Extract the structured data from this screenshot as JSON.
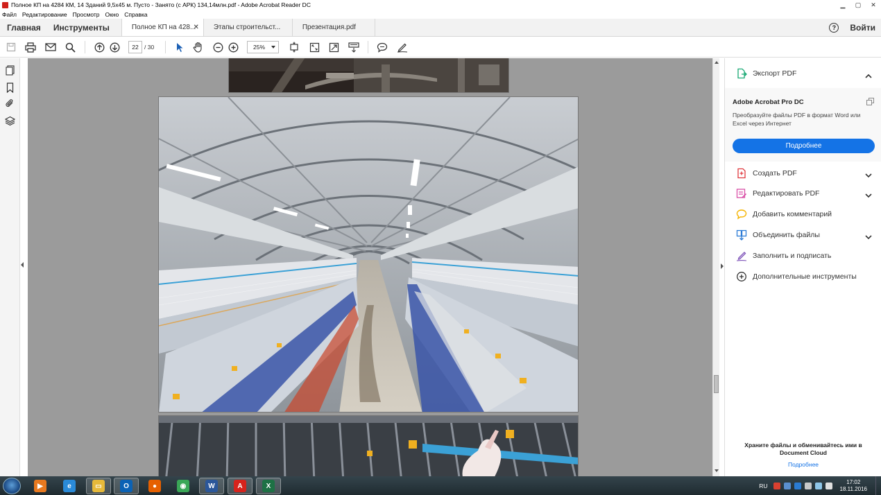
{
  "window": {
    "title": "Полное КП на 4284 КМ, 14 Зданий 9,5х45 м. Пусто - Занято (с АРК) 134,14млн.pdf - Adobe Acrobat Reader DC"
  },
  "menu": [
    "Файл",
    "Редактирование",
    "Просмотр",
    "Окно",
    "Справка"
  ],
  "tabbar": {
    "home": "Главная",
    "tools": "Инструменты",
    "docs": [
      {
        "label": "Полное КП на 428...",
        "active": true
      },
      {
        "label": "Этапы строительст...",
        "active": false
      },
      {
        "label": "Презентация.pdf",
        "active": false
      }
    ],
    "help_icon": "?",
    "login": "Войти"
  },
  "toolbar": {
    "page_current": "22",
    "page_total": "/ 30",
    "zoom": "25%"
  },
  "right_panel": {
    "export_label": "Экспорт PDF",
    "promo": {
      "title": "Adobe Acrobat Pro DC",
      "description": "Преобразуйте файлы PDF в формат Word или Excel через Интернет",
      "button": "Подробнее"
    },
    "tools": [
      {
        "label": "Создать PDF",
        "icon": "create-pdf-icon",
        "color": "#e0383e",
        "expandable": true
      },
      {
        "label": "Редактировать PDF",
        "icon": "edit-pdf-icon",
        "color": "#d94fa6",
        "expandable": true
      },
      {
        "label": "Добавить комментарий",
        "icon": "comment-icon",
        "color": "#f5b400",
        "expandable": false
      },
      {
        "label": "Объединить файлы",
        "icon": "combine-files-icon",
        "color": "#2b7bd6",
        "expandable": true
      },
      {
        "label": "Заполнить и подписать",
        "icon": "fill-sign-icon",
        "color": "#7b4fb7",
        "expandable": false
      },
      {
        "label": "Дополнительные инструменты",
        "icon": "more-tools-icon",
        "color": "#333333",
        "expandable": false
      }
    ],
    "bottom_text": "Храните файлы и обменивайтесь ими в Document Cloud",
    "bottom_link": "Подробнее"
  },
  "taskbar": {
    "apps": [
      {
        "name": "media-player-icon",
        "glyph": "▶",
        "color": "#e8791f",
        "open": false
      },
      {
        "name": "internet-explorer-icon",
        "glyph": "e",
        "color": "#2a8ad8",
        "open": false
      },
      {
        "name": "file-explorer-icon",
        "glyph": "▭",
        "color": "#e6b93a",
        "open": true
      },
      {
        "name": "outlook-icon",
        "glyph": "O",
        "color": "#0b62b5",
        "open": true
      },
      {
        "name": "firefox-icon",
        "glyph": "●",
        "color": "#e66000",
        "open": false
      },
      {
        "name": "chrome-icon",
        "glyph": "◉",
        "color": "#3aa757",
        "open": false
      },
      {
        "name": "word-icon",
        "glyph": "W",
        "color": "#2b579a",
        "open": true
      },
      {
        "name": "acrobat-reader-icon",
        "glyph": "A",
        "color": "#d6231c",
        "open": true
      },
      {
        "name": "excel-icon",
        "glyph": "X",
        "color": "#1e7145",
        "open": true
      }
    ],
    "lang": "RU",
    "time": "17:02",
    "date": "18.11.2016"
  }
}
